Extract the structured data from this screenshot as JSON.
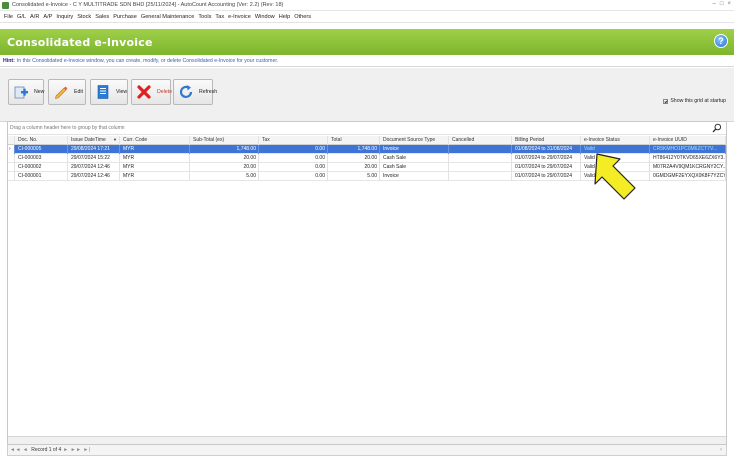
{
  "window": {
    "title": "Consolidated e-Invoice - C Y MULTITRADE SDN BHD [25/11/2024] - AutoCount Accounting (Ver: 2.2) (Rev: 18)",
    "controls": [
      "–",
      "□",
      "×"
    ]
  },
  "menu": [
    "File",
    "G/L",
    "A/R",
    "A/P",
    "Inquiry",
    "Stock",
    "Sales",
    "Purchase",
    "General Maintenance",
    "Tools",
    "Tax",
    "e-Invoice",
    "Window",
    "Help",
    "Others"
  ],
  "header": {
    "title": "Consolidated e-Invoice",
    "help_label": "?"
  },
  "hint": {
    "label": "Hint:",
    "text": "In this Consolidated e-Invoice window, you can create, modify, or delete Consolidated e-Invoice for your customer."
  },
  "toolbar": {
    "buttons": [
      {
        "label": "New",
        "icon": "plus-document-icon"
      },
      {
        "label": "Edit",
        "icon": "pencil-icon"
      },
      {
        "label": "View",
        "icon": "document-icon"
      },
      {
        "label": "Delete",
        "icon": "red-x-icon"
      },
      {
        "label": "Refresh",
        "icon": "refresh-icon"
      }
    ],
    "show_grid_label": "Show this grid at startup",
    "show_grid_checked": true
  },
  "grid": {
    "group_hint": "Drag a column header here to group by that column",
    "columns": [
      "Doc. No.",
      "Issue DateTime",
      "Curr. Code",
      "Sub-Total (ex)",
      "Tax",
      "Total",
      "Document Source Type",
      "Cancelled",
      "Billing Period",
      "e-Invoice Status",
      "e-Invoice UUID"
    ],
    "sort_indicator": "▼",
    "rows": [
      [
        "CI-000005",
        "29/08/2024 17:21",
        "MYR",
        "1,748.00",
        "0.00",
        "1,748.00",
        "Invoice",
        "",
        "01/08/2024 to 31/08/2024",
        "Valid",
        "CR5KMHO1PC0M6ZCT7V..."
      ],
      [
        "CI-000003",
        "29/07/2024 15:22",
        "MYR",
        "20.00",
        "0.00",
        "20.00",
        "Cash Sale",
        "",
        "01/07/2024 to 29/07/2024",
        "Valid",
        "HT86412Y0TKVD65XE6ZX6Y3..."
      ],
      [
        "CI-000002",
        "29/07/2024 12:46",
        "MYR",
        "20.00",
        "0.00",
        "20.00",
        "Cash Sale",
        "",
        "01/07/2024 to 29/07/2024",
        "Valid",
        "M07R2A4V9QM1KCRGNY2CY..."
      ],
      [
        "CI-000001",
        "29/07/2024 12:46",
        "MYR",
        "5.00",
        "0.00",
        "5.00",
        "Invoice",
        "",
        "01/07/2024 to 29/07/2024",
        "Valid",
        "0GMDGMF2EYXQX0K8F7YZCY..."
      ]
    ],
    "selected_row": 0
  },
  "status": {
    "nav": "◄◄ ◄",
    "record": "Record 1 of 4",
    "nav_next": "► ►► ►|",
    "right": "›"
  },
  "colors": {
    "header_green": "#8bc13a",
    "selection_blue": "#3d74d6",
    "arrow_yellow": "#f4ec25"
  }
}
